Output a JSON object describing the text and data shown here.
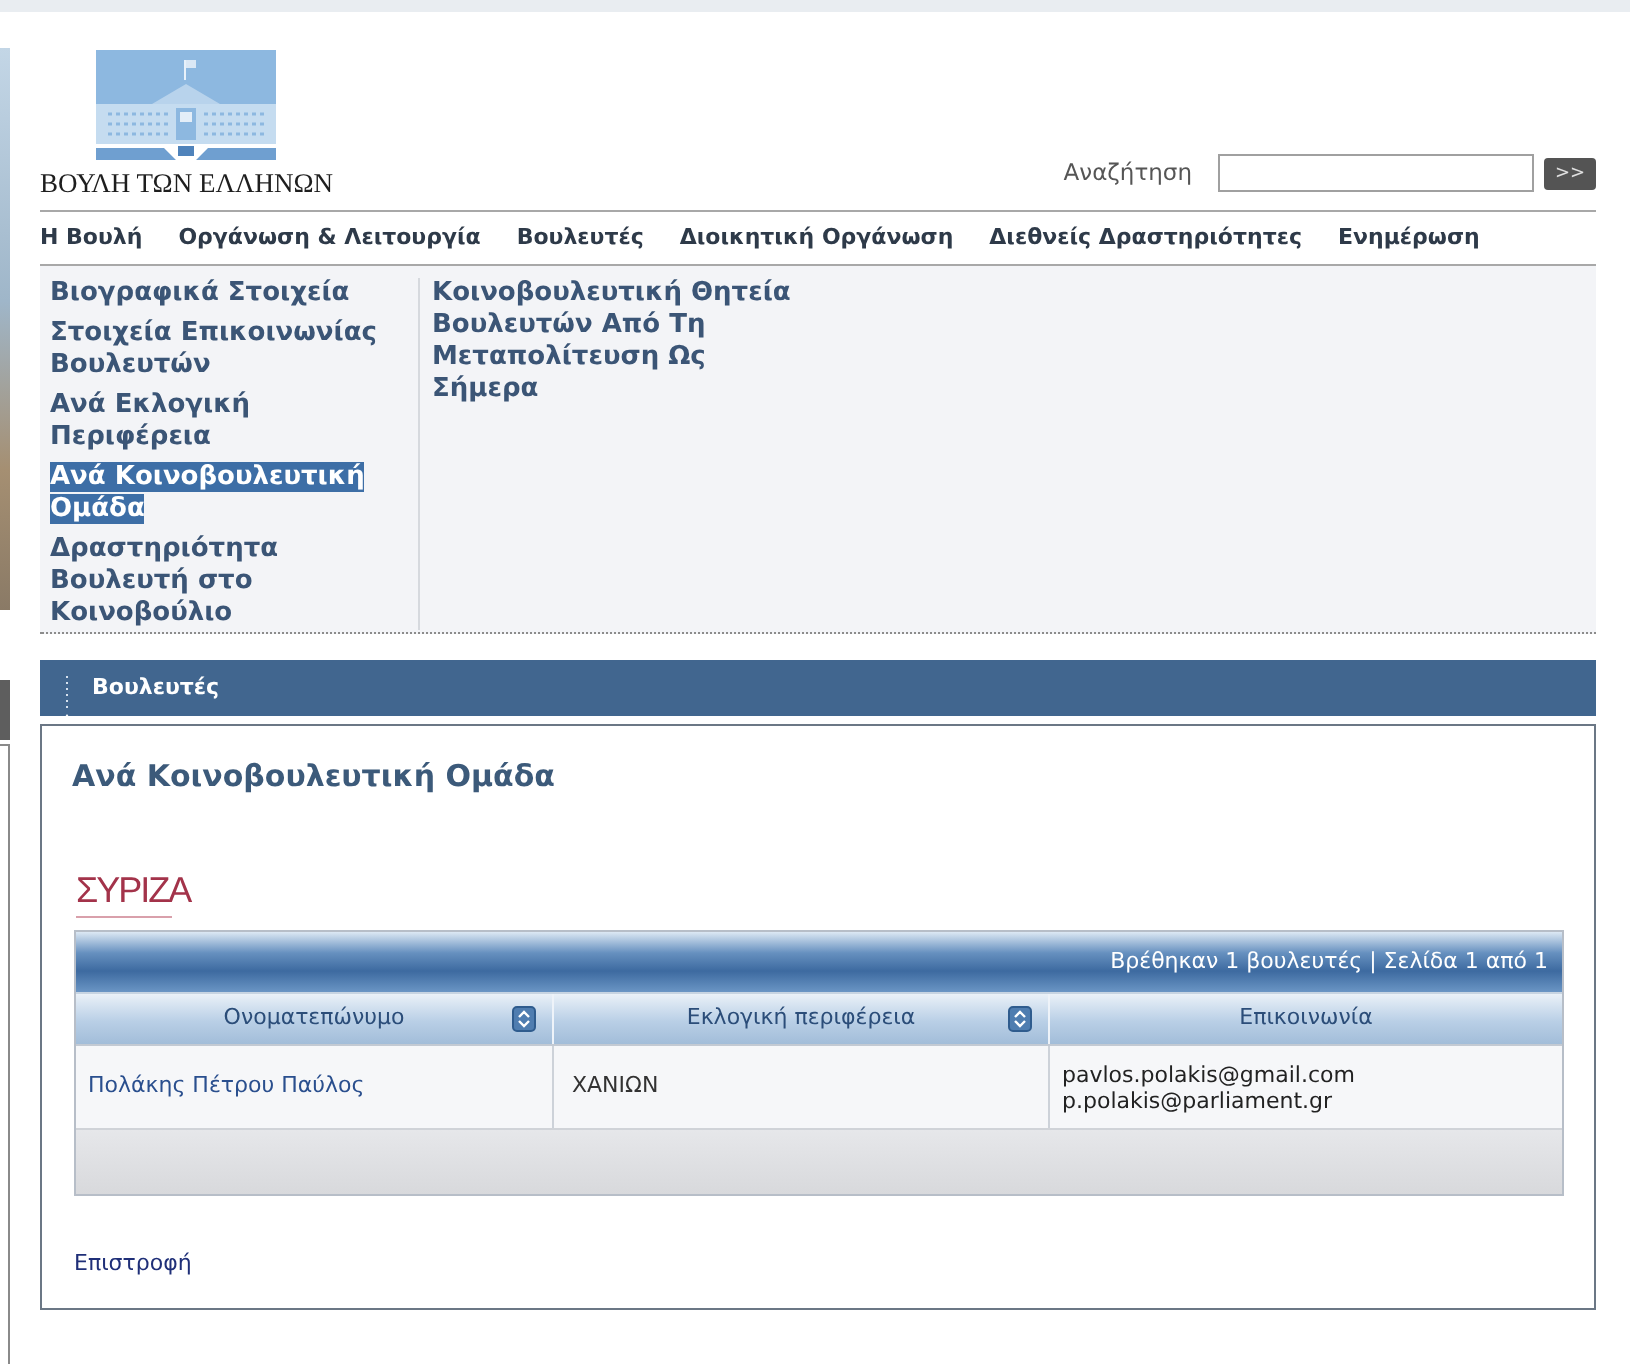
{
  "site": {
    "title": "ΒΟΥΛΗ ΤΩΝ ΕΛΛΗΝΩΝ"
  },
  "search": {
    "label": "Αναζήτηση",
    "button": ">>"
  },
  "nav": [
    {
      "label": "Η Βουλή"
    },
    {
      "label": "Οργάνωση & Λειτουργία"
    },
    {
      "label": "Βουλευτές"
    },
    {
      "label": "Διοικητική Οργάνωση"
    },
    {
      "label": "Διεθνείς Δραστηριότητες"
    },
    {
      "label": "Ενημέρωση"
    }
  ],
  "submenu": {
    "columns": [
      {
        "items": [
          {
            "label": "Βιογραφικά Στοιχεία",
            "selected": false
          },
          {
            "label": "Στοιχεία Επικοινωνίας Βουλευτών",
            "selected": false
          },
          {
            "label": "Ανά Εκλογική Περιφέρεια",
            "selected": false
          },
          {
            "label": "Ανά Κοινοβουλευτική Ομάδα",
            "selected": true
          },
          {
            "label": "Δραστηριότητα Βουλευτή στο Κοινοβούλιο",
            "selected": false
          }
        ]
      },
      {
        "items": [
          {
            "label": "Κοινοβουλευτική Θητεία Βουλευτών Από Τη Μεταπολίτευση Ως Σήμερα",
            "selected": false
          }
        ]
      }
    ]
  },
  "panel": {
    "tab": "Βουλευτές",
    "heading": "Ανά Κοινοβουλευτική Ομάδα",
    "party_logo": "ΣΥΡΙΖΑ",
    "table": {
      "summary": "Βρέθηκαν 1 βουλευτές | Σελίδα 1 από 1",
      "columns": [
        {
          "label": "Ονοματεπώνυμο",
          "sortable": true
        },
        {
          "label": "Εκλογική περιφέρεια",
          "sortable": true
        },
        {
          "label": "Επικοινωνία",
          "sortable": false
        }
      ],
      "rows": [
        {
          "name": "Πολάκης Πέτρου Παύλος",
          "constituency": "ΧΑΝΙΩΝ",
          "contacts": [
            "pavlos.polakis@gmail.com",
            "p.polakis@parliament.gr"
          ]
        }
      ]
    },
    "back_link": "Επιστροφή"
  }
}
